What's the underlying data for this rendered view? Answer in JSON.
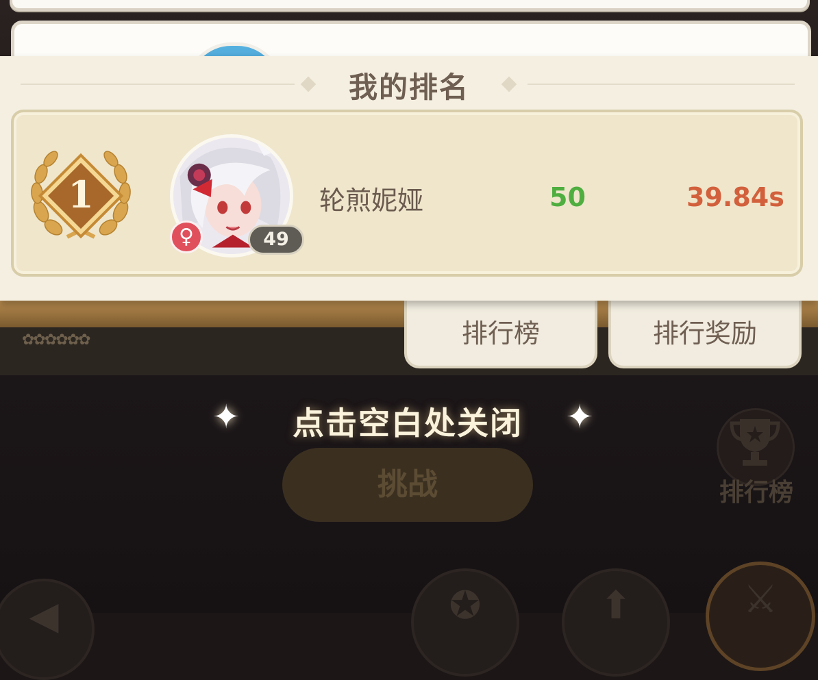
{
  "my_rank": {
    "title": "我的排名",
    "rank": "1",
    "player": {
      "name": "轮煎妮娅",
      "level": "49",
      "gender_symbol": "♀",
      "score": "50",
      "time": "39.84s"
    }
  },
  "tabs": [
    {
      "label": "排行榜"
    },
    {
      "label": "排行奖励"
    }
  ],
  "close_hint": "点击空白处关闭",
  "sparkle_glyph": "✦",
  "challenge_button": "挑战",
  "leaderboard_shortcut": {
    "label": "排行榜",
    "icon": "trophy-icon"
  },
  "colors": {
    "score_green": "#4fae3f",
    "time_orange": "#d2603c",
    "rank_gold": "#c58a35"
  }
}
